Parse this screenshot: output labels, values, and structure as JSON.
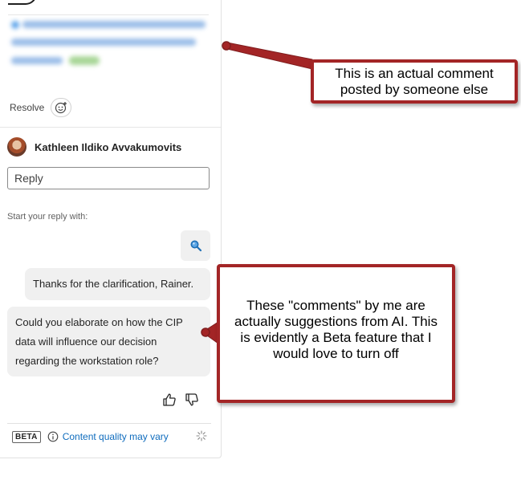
{
  "comment": {
    "resolve_label": "Resolve"
  },
  "reply": {
    "author_name": "Kathleen Ildiko Avvakumovits",
    "placeholder": "Reply",
    "hint": "Start your reply with:"
  },
  "suggestions": [
    {
      "text": "Thanks for the clarification, Rainer."
    },
    {
      "text": "Could you elaborate on how the CIP data will influence our decision regarding the workstation role?"
    }
  ],
  "footer": {
    "beta_label": "BETA",
    "quality_text": "Content quality may vary"
  },
  "annotations": [
    {
      "text": "This is an actual comment posted by someone else"
    },
    {
      "text": "These \"comments\" by me are actually suggestions from AI. This is evidently a Beta feature that I would love to turn off"
    }
  ],
  "colors": {
    "annotation_border": "#a32526",
    "link": "#0f6cbd",
    "suggestion_bg": "#f0f0f0"
  },
  "icons": [
    "emoji-add-icon",
    "search-icon",
    "thumbs-up-icon",
    "thumbs-down-icon",
    "info-icon",
    "sparkle-icon"
  ]
}
